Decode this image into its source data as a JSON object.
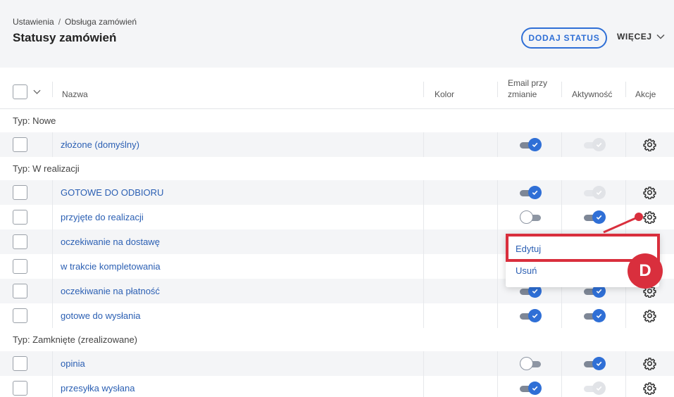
{
  "breadcrumb": {
    "root": "Ustawienia",
    "separator": "/",
    "current": "Obsługa zamówień"
  },
  "page_title": "Statusy zamówień",
  "actions": {
    "add_status": "DODAJ STATUS",
    "more": "WIĘCEJ"
  },
  "columns": {
    "name": "Nazwa",
    "color": "Kolor",
    "email_line1": "Email przy",
    "email_line2": "zmianie",
    "activity": "Aktywność",
    "actions": "Akcje"
  },
  "groups": [
    {
      "label": "Typ: Nowe",
      "rows": [
        {
          "name": "złożone (domyślny)",
          "email": "on",
          "active": "on-disabled"
        }
      ]
    },
    {
      "label": "Typ: W realizacji",
      "rows": [
        {
          "name": "GOTOWE DO ODBIORU",
          "email": "on",
          "active": "on-disabled"
        },
        {
          "name": "przyjęte do realizacji",
          "email": "off",
          "active": "on"
        },
        {
          "name": "oczekiwanie na dostawę",
          "email": "on",
          "active": "on"
        },
        {
          "name": "w trakcie kompletowania",
          "email": "on",
          "active": "on"
        },
        {
          "name": "oczekiwanie na płatność",
          "email": "on",
          "active": "on"
        },
        {
          "name": "gotowe do wysłania",
          "email": "on",
          "active": "on"
        }
      ]
    },
    {
      "label": "Typ: Zamknięte (zrealizowane)",
      "rows": [
        {
          "name": "opinia",
          "email": "off",
          "active": "on"
        },
        {
          "name": "przesyłka wysłana",
          "email": "on",
          "active": "on-disabled"
        }
      ]
    }
  ],
  "context_menu": {
    "edit": "Edytuj",
    "delete": "Usuń"
  },
  "callout": {
    "label": "D",
    "color": "#d92f3d"
  },
  "colors": {
    "accent": "#2f6fd6",
    "link": "#2b5fb3",
    "highlight": "#d92f3d"
  },
  "icons": {
    "settings": "gear-icon",
    "toggle_check": "check-icon",
    "dropdown": "chevron-down-icon"
  }
}
